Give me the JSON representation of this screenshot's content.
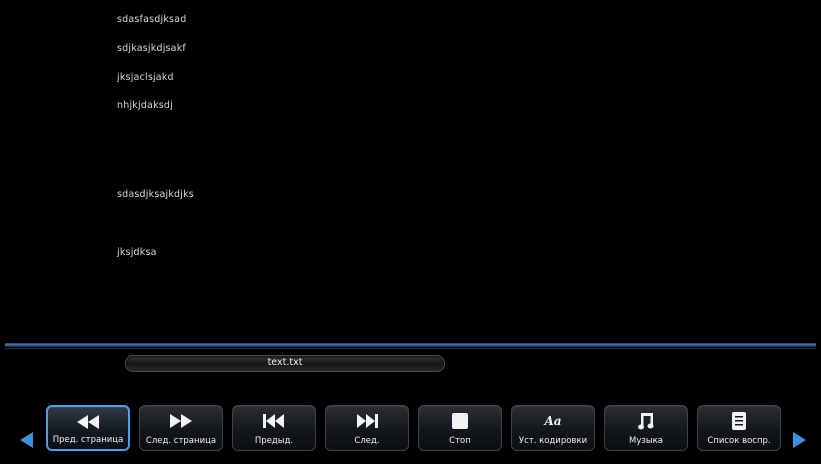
{
  "document": {
    "lines": [
      "sdasfasdjksad",
      "sdjkasjkdjsakf",
      "jksjaclsjakd",
      "nhjkjdaksdj",
      "sdasdjksajkdjks",
      "jksjdksa"
    ]
  },
  "file": {
    "name": "text.txt"
  },
  "toolbar": {
    "buttons": [
      {
        "label": "Пред. страница",
        "icon": "rewind-icon"
      },
      {
        "label": "След. страница",
        "icon": "fast-forward-icon"
      },
      {
        "label": "Предыд.",
        "icon": "skip-previous-icon"
      },
      {
        "label": "След.",
        "icon": "skip-next-icon"
      },
      {
        "label": "Стоп",
        "icon": "stop-icon"
      },
      {
        "label": "Уст. кодировки",
        "icon": "font-encoding-icon"
      },
      {
        "label": "Музыка",
        "icon": "music-note-icon"
      },
      {
        "label": "Список воспр.",
        "icon": "playlist-icon"
      }
    ],
    "active_index": 0
  },
  "colors": {
    "accent": "#4ea0ea",
    "background": "#000000",
    "divider": "#4a77b0"
  }
}
